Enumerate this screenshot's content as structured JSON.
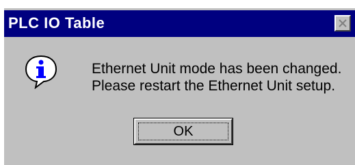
{
  "window": {
    "title": "PLC IO Table",
    "close_icon": "close-icon"
  },
  "message": {
    "icon": "info-icon",
    "line1": "Ethernet Unit mode has been changed.",
    "line2": "Please restart the Ethernet Unit setup."
  },
  "buttons": {
    "ok_label": "OK"
  },
  "colors": {
    "titlebar": "#000080",
    "dialog_bg": "#c0c0c0",
    "title_text": "#ffffff",
    "icon_blue": "#0000ff"
  }
}
